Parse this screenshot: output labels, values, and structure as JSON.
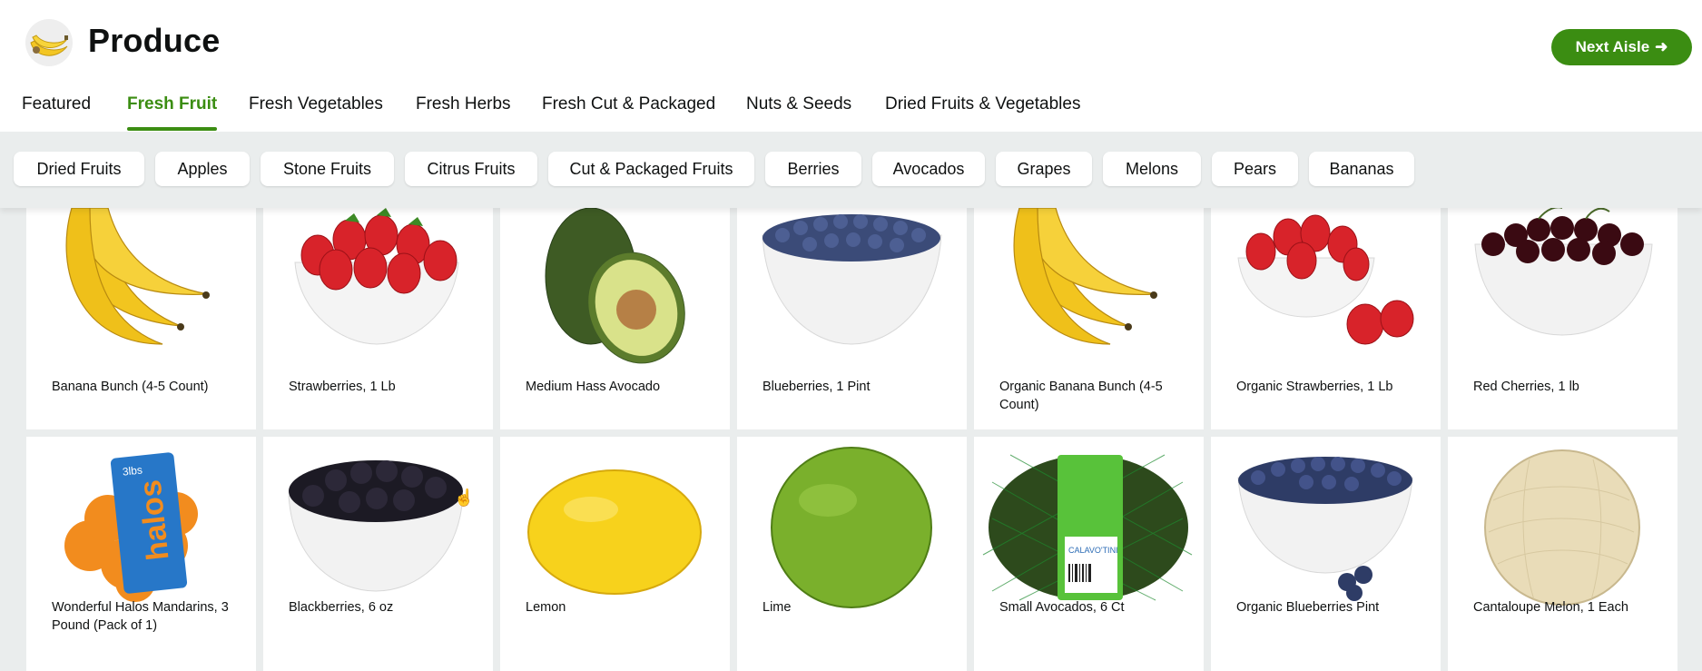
{
  "header": {
    "title": "Produce",
    "logo_icon": "banana-icon",
    "next_button": {
      "label": "Next Aisle",
      "icon": "arrow-right-icon",
      "color": "#3b8d12"
    }
  },
  "tabs": [
    {
      "label": "Featured",
      "active": false
    },
    {
      "label": "Fresh Fruit",
      "active": true
    },
    {
      "label": "Fresh Vegetables",
      "active": false
    },
    {
      "label": "Fresh Herbs",
      "active": false
    },
    {
      "label": "Fresh Cut & Packaged",
      "active": false
    },
    {
      "label": "Nuts & Seeds",
      "active": false
    },
    {
      "label": "Dried Fruits & Vegetables",
      "active": false
    }
  ],
  "chips": [
    "Dried Fruits",
    "Apples",
    "Stone Fruits",
    "Citrus Fruits",
    "Cut & Packaged Fruits",
    "Berries",
    "Avocados",
    "Grapes",
    "Melons",
    "Pears",
    "Bananas"
  ],
  "products": [
    {
      "name": "Banana Bunch (4-5 Count)",
      "image": "banana-bunch-image"
    },
    {
      "name": "Strawberries, 1 Lb",
      "image": "strawberries-bowl-image"
    },
    {
      "name": "Medium Hass Avocado",
      "image": "avocado-image"
    },
    {
      "name": "Blueberries, 1 Pint",
      "image": "blueberries-bowl-image"
    },
    {
      "name": "Organic Banana Bunch (4-5 Count)",
      "image": "banana-bunch-image"
    },
    {
      "name": "Organic Strawberries, 1 Lb",
      "image": "strawberries-bowl-image"
    },
    {
      "name": "Red Cherries, 1 lb",
      "image": "cherries-bowl-image"
    },
    {
      "name": "Wonderful Halos Mandarins, 3 Pound (Pack of 1)",
      "image": "halos-bag-image"
    },
    {
      "name": "Blackberries, 6 oz",
      "image": "blackberries-bowl-image"
    },
    {
      "name": "Lemon",
      "image": "lemon-image"
    },
    {
      "name": "Lime",
      "image": "lime-image"
    },
    {
      "name": "Small Avocados, 6 Ct",
      "image": "avocado-bag-image"
    },
    {
      "name": "Organic Blueberries Pint",
      "image": "blueberries-bowl-image"
    },
    {
      "name": "Cantaloupe Melon, 1 Each",
      "image": "cantaloupe-image"
    }
  ],
  "colors": {
    "accent": "#3b8d12",
    "background": "#eaeded",
    "text": "#0f1111"
  }
}
